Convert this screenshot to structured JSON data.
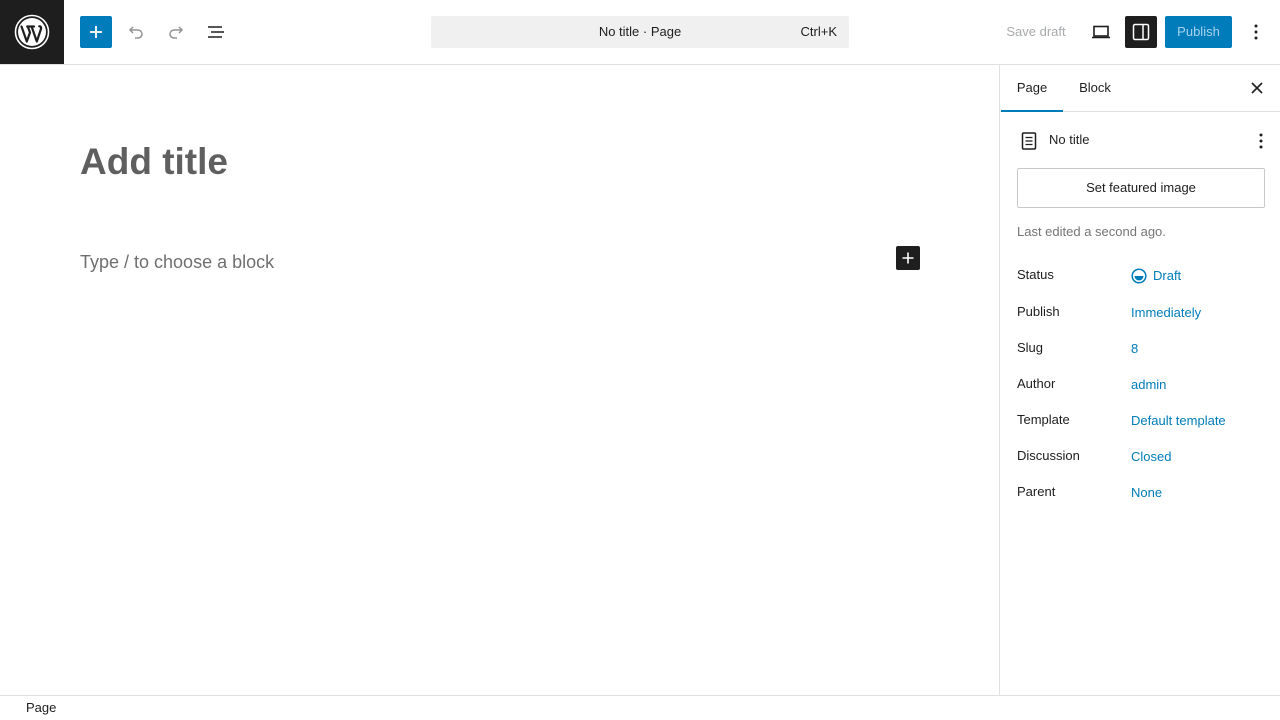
{
  "header": {
    "logo_icon": "wordpress-icon",
    "inserter_icon": "plus-icon",
    "undo_icon": "undo-icon",
    "redo_icon": "redo-icon",
    "list_view_icon": "list-view-icon",
    "command_bar": {
      "title": "No title · Page",
      "shortcut": "Ctrl+K"
    },
    "save_draft_label": "Save draft",
    "preview_icon": "desktop-icon",
    "settings_icon": "sidebar-icon",
    "publish_label": "Publish",
    "options_icon": "more-vertical-icon",
    "accent_color": "#007cba"
  },
  "canvas": {
    "title_placeholder": "Add title",
    "block_placeholder": "Type / to choose a block",
    "inline_inserter_icon": "plus-icon"
  },
  "sidebar": {
    "tabs": [
      {
        "label": "Page",
        "active": true
      },
      {
        "label": "Block",
        "active": false
      }
    ],
    "close_icon": "close-icon",
    "document": {
      "icon": "page-icon",
      "title": "No title",
      "more_icon": "more-vertical-icon"
    },
    "featured_image_label": "Set featured image",
    "last_edited": "Last edited a second ago.",
    "meta": [
      {
        "label": "Status",
        "value": "Draft",
        "icon": "draft-icon"
      },
      {
        "label": "Publish",
        "value": "Immediately"
      },
      {
        "label": "Slug",
        "value": "8"
      },
      {
        "label": "Author",
        "value": "admin"
      },
      {
        "label": "Template",
        "value": "Default template"
      },
      {
        "label": "Discussion",
        "value": "Closed"
      },
      {
        "label": "Parent",
        "value": "None"
      }
    ]
  },
  "footer": {
    "breadcrumb": [
      "Page"
    ]
  }
}
